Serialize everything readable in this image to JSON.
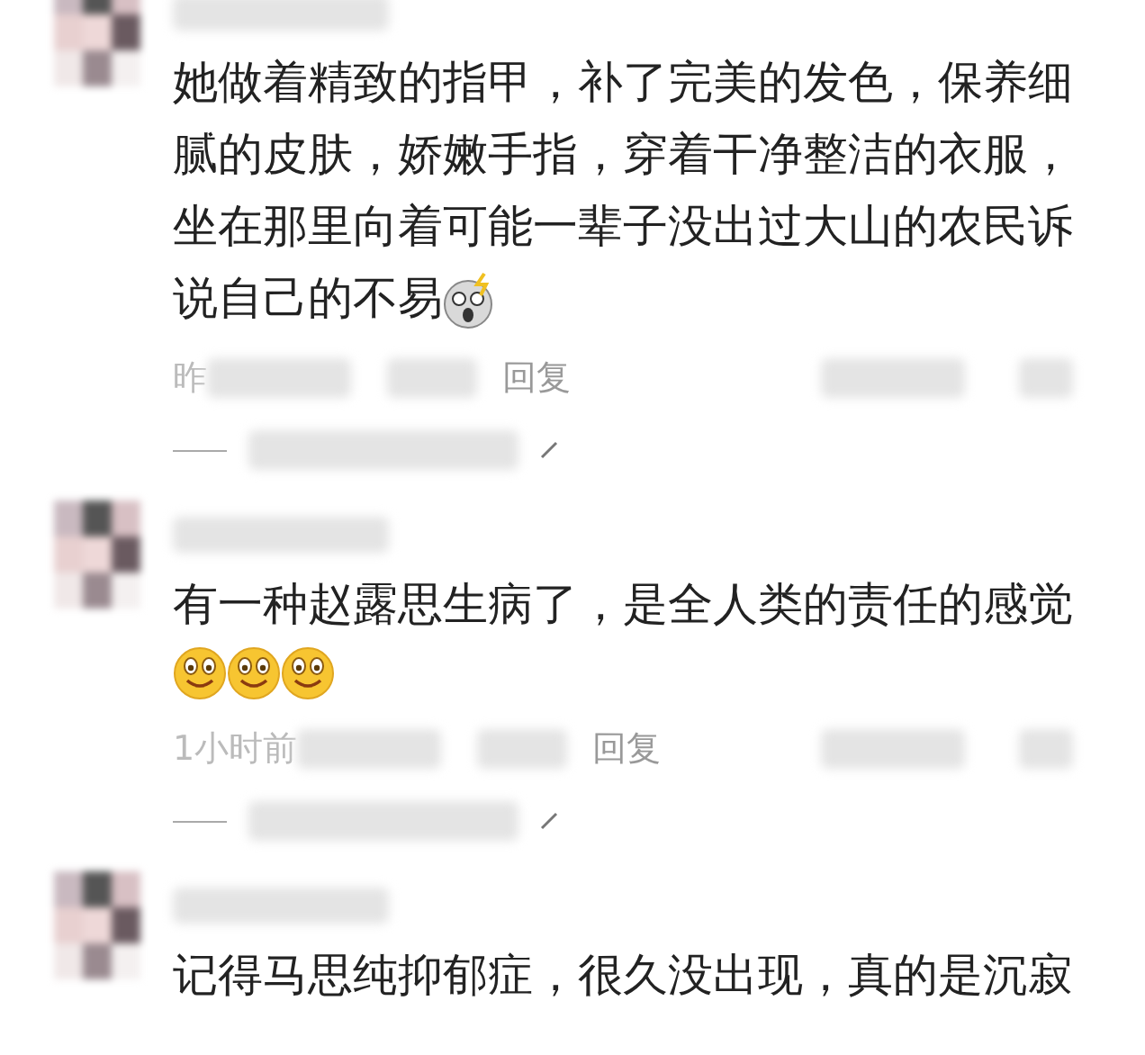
{
  "comments": [
    {
      "text": "她做着精致的指甲，补了完美的发色，保养细腻的皮肤，娇嫩手指，穿着干净整洁的衣服，坐在那里向着可能一辈子没出过大山的农民诉说自己的不易",
      "emojis": [
        {
          "kind": "shocked"
        }
      ],
      "time": "昨",
      "reply": "回复",
      "has_replies": true
    },
    {
      "text": "有一种赵露思生病了，是全人类的责任的感觉",
      "emojis": [
        {
          "kind": "smile"
        },
        {
          "kind": "smile"
        },
        {
          "kind": "smile"
        }
      ],
      "time": "1小时前",
      "reply": "回复",
      "has_replies": true
    },
    {
      "text": "记得马思纯抑郁症，很久没出现，真的是沉寂"
    }
  ]
}
